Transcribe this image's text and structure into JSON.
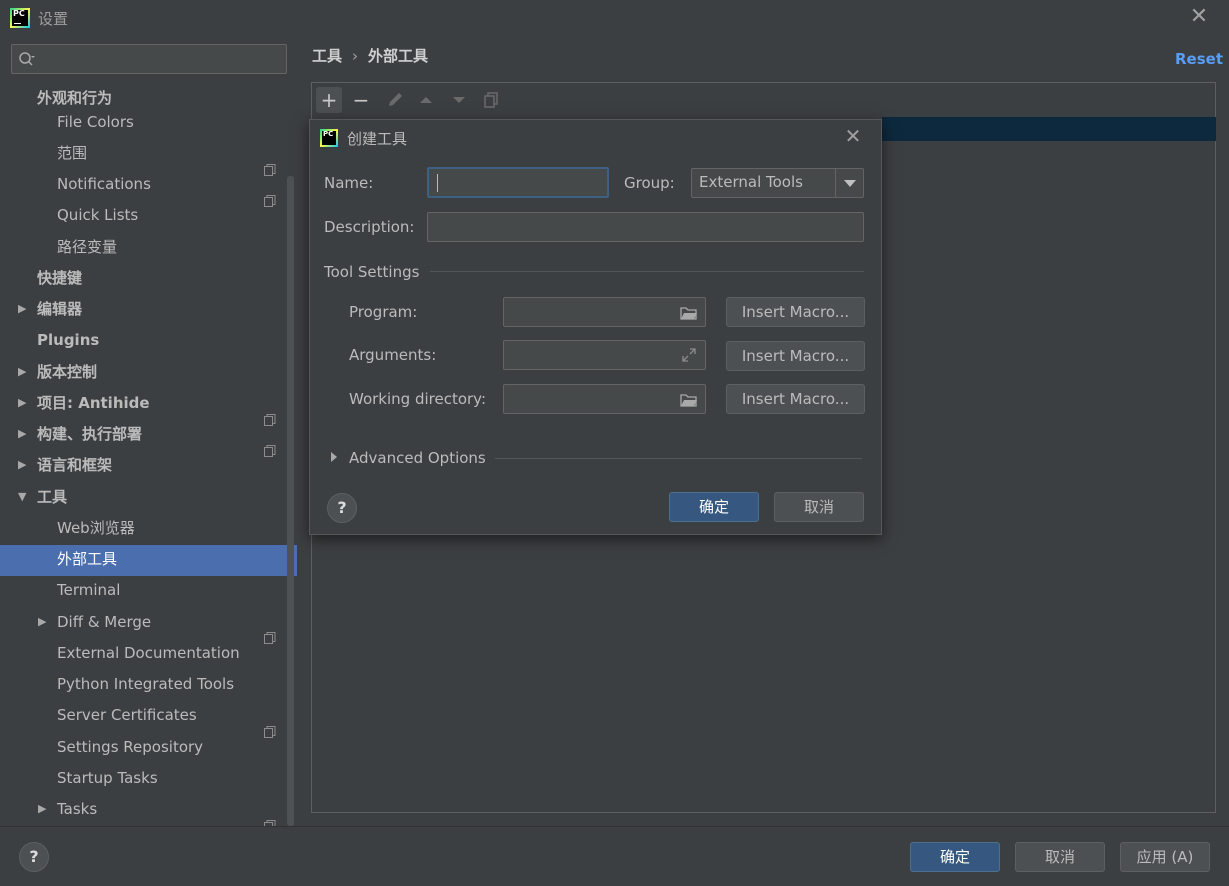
{
  "window": {
    "title": "设置",
    "logo_text": "PC"
  },
  "search": {
    "placeholder": ""
  },
  "tree": {
    "appearance": "外观和行为",
    "file_colors": "File Colors",
    "scopes": "范围",
    "notifications": "Notifications",
    "quick_lists": "Quick Lists",
    "path_variables": "路径变量",
    "keymap": "快捷键",
    "editor": "编辑器",
    "plugins": "Plugins",
    "vcs": "版本控制",
    "project": "项目: Antihide",
    "build": "构建、执行部署",
    "languages": "语言和框架",
    "tools": "工具",
    "web_browsers": "Web浏览器",
    "external_tools": "外部工具",
    "terminal": "Terminal",
    "diff_merge": "Diff & Merge",
    "external_docs": "External Documentation",
    "python_tools": "Python Integrated Tools",
    "server_certs": "Server Certificates",
    "settings_repo": "Settings Repository",
    "startup_tasks": "Startup Tasks",
    "tasks": "Tasks"
  },
  "main": {
    "breadcrumb_parent": "工具",
    "breadcrumb_sep": "›",
    "breadcrumb_current": "外部工具",
    "reset": "Reset"
  },
  "toolbar": {
    "add": "+",
    "remove": "−"
  },
  "dialog": {
    "title": "创建工具",
    "logo_text": "PC",
    "name_label": "Name:",
    "name_value": "",
    "group_label": "Group:",
    "group_value": "External Tools",
    "description_label": "Description:",
    "description_value": "",
    "tool_settings": "Tool Settings",
    "program_label": "Program:",
    "arguments_label": "Arguments:",
    "working_dir_label": "Working directory:",
    "insert_macro": "Insert Macro...",
    "advanced_options": "Advanced Options",
    "ok": "确定",
    "cancel": "取消",
    "help": "?"
  },
  "footer": {
    "help": "?",
    "ok": "确定",
    "cancel": "取消",
    "apply": "应用 (A)"
  }
}
